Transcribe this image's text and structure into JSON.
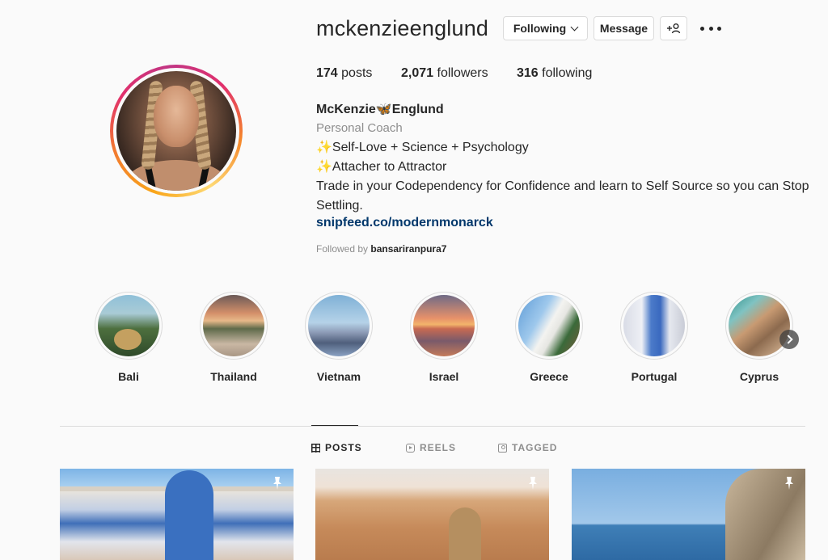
{
  "profile": {
    "username": "mckenzieenglund",
    "following_label": "Following",
    "message_label": "Message",
    "suggest_label": "+웃"
  },
  "stats": {
    "posts_count": "174",
    "posts_label": " posts",
    "followers_count": "2,071",
    "followers_label": " followers",
    "following_count": "316",
    "following_label": " following"
  },
  "bio": {
    "full_name": "McKenzie🦋Englund",
    "category": "Personal Coach",
    "line1": "✨Self-Love + Science + Psychology",
    "line2": "✨Attacher to Attractor",
    "line3": "Trade in your Codependency for Confidence and learn to Self Source so you can Stop Settling.",
    "link": "snipfeed.co/modernmonarck",
    "followed_by_prefix": "Followed by ",
    "followed_by_user": "bansariranpura7"
  },
  "highlights": [
    {
      "label": "Bali"
    },
    {
      "label": "Thailand"
    },
    {
      "label": "Vietnam"
    },
    {
      "label": "Israel"
    },
    {
      "label": "Greece"
    },
    {
      "label": "Portugal"
    },
    {
      "label": "Cyprus"
    }
  ],
  "tabs": {
    "posts": "POSTS",
    "reels": "REELS",
    "tagged": "TAGGED"
  },
  "colors": {
    "link": "#00376b",
    "secondary_text": "#8e8e8e",
    "border": "#dbdbdb",
    "background": "#fafafa"
  },
  "icons": {
    "more": "more-horizontal-icon",
    "pin": "pin-icon",
    "next": "chevron-right-icon"
  }
}
